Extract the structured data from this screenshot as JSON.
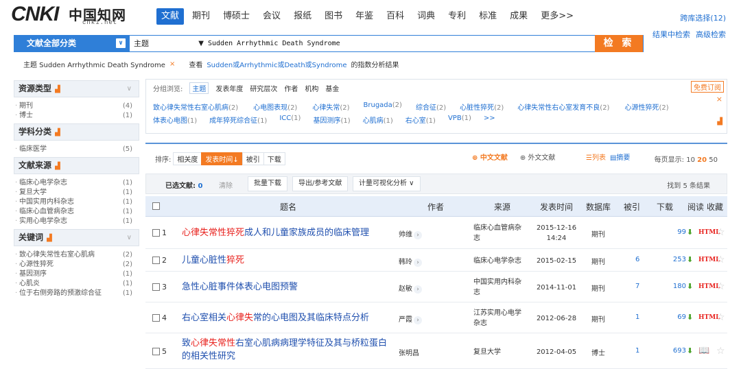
{
  "logo": {
    "mark": "CNKI",
    "cn": "中国知网",
    "sub": "cnki.net"
  },
  "nav": [
    "文献",
    "期刊",
    "博硕士",
    "会议",
    "报纸",
    "图书",
    "年鉴",
    "百科",
    "词典",
    "专利",
    "标准",
    "成果",
    "更多>>"
  ],
  "cross_db": "跨库选择(12)",
  "links": [
    "结果中检索",
    "高级检索"
  ],
  "search": {
    "category": "文献全部分类",
    "category_arrow": "∨",
    "field": "主题",
    "query": "Sudden Arrhythmic Death Syndrome",
    "button": "检 索"
  },
  "crumb": {
    "label": "主题 Sudden Arrhythmic Death Syndrome",
    "close": "×",
    "view_prefix": "查看",
    "terms": "Sudden或Arrhythmic或Death或Syndrome",
    "suffix": "的指数分析结果"
  },
  "sidebar": [
    {
      "title": "资源类型",
      "chev": "∨",
      "items": [
        {
          "label": "期刊",
          "count": "(4)"
        },
        {
          "label": "博士",
          "count": "(1)"
        }
      ]
    },
    {
      "title": "学科分类",
      "chev": "",
      "items": [
        {
          "label": "临床医学",
          "count": "(5)"
        }
      ]
    },
    {
      "title": "文献来源",
      "chev": "",
      "items": [
        {
          "label": "临床心电学杂志",
          "count": "(1)"
        },
        {
          "label": "复旦大学",
          "count": "(1)"
        },
        {
          "label": "中国实用内科杂志",
          "count": "(1)"
        },
        {
          "label": "临床心血管病杂志",
          "count": "(1)"
        },
        {
          "label": "实用心电学杂志",
          "count": "(1)"
        }
      ]
    },
    {
      "title": "关键词",
      "chev": "∨",
      "items": [
        {
          "label": "致心律失常性右室心肌病",
          "count": "(2)"
        },
        {
          "label": "心源性猝死",
          "count": "(2)"
        },
        {
          "label": "基因测序",
          "count": "(1)"
        },
        {
          "label": "心肌炎",
          "count": "(1)"
        },
        {
          "label": "位于右侧旁路的预激综合征",
          "count": "(1)"
        }
      ]
    }
  ],
  "group": {
    "label": "分组浏览:",
    "tabs": [
      "主题",
      "发表年度",
      "研究层次",
      "作者",
      "机构",
      "基金"
    ],
    "subscribe": "免费订阅",
    "close": "×",
    "row1": [
      {
        "t": "致心律失常性右室心肌病",
        "n": "(2)"
      },
      {
        "t": "心电图表现",
        "n": "(2)"
      },
      {
        "t": "心律失常",
        "n": "(2)"
      },
      {
        "t": "Brugada",
        "n": "(2)"
      },
      {
        "t": "综合征",
        "n": "(2)"
      },
      {
        "t": "心脏性猝死",
        "n": "(2)"
      },
      {
        "t": "心律失常性右心室发育不良",
        "n": "(2)"
      },
      {
        "t": "心源性猝死",
        "n": "(2)"
      }
    ],
    "row2": [
      {
        "t": "体表心电图",
        "n": "(1)"
      },
      {
        "t": "成年猝死综合征",
        "n": "(1)"
      },
      {
        "t": "ICC",
        "n": "(1)"
      },
      {
        "t": "基因测序",
        "n": "(1)"
      },
      {
        "t": "心肌病",
        "n": "(1)"
      },
      {
        "t": "右心室",
        "n": "(1)"
      },
      {
        "t": "VPB",
        "n": "(1)"
      },
      {
        "t": ">>",
        "n": ""
      }
    ]
  },
  "sort": {
    "label": "排序:",
    "opts": [
      "相关度",
      "发表时间↓",
      "被引",
      "下载"
    ]
  },
  "langs": {
    "cn": "中文文献",
    "en": "外文文献"
  },
  "views": {
    "list": "列表",
    "abstract": "摘要"
  },
  "perpage": {
    "label": "每页显示:",
    "opts": [
      "10",
      "20",
      "50"
    ]
  },
  "selbar": {
    "label": "已选文献:",
    "count": "0",
    "clear": "清除",
    "buttons": [
      "批量下载",
      "导出/参考文献",
      "计量可视化分析 ∨"
    ],
    "found": "找到 5 条结果"
  },
  "thead": {
    "title": "题名",
    "author": "作者",
    "source": "来源",
    "date": "发表时间",
    "db": "数据库",
    "cited": "被引",
    "dl": "下载",
    "read": "阅读",
    "fav": "收藏"
  },
  "rows": [
    {
      "n": "1",
      "t1": "",
      "kw": "心律失常性猝死",
      "t2": "成人和儿童家族成员的临床管理",
      "author": "帅维",
      "src": "临床心血管病杂志",
      "date": "2015-12-16 14:24",
      "db": "期刊",
      "cited": "",
      "dl": "99",
      "read": "HTML"
    },
    {
      "n": "2",
      "t1": "儿童心脏性",
      "kw": "猝死",
      "t2": "",
      "author": "韩玲",
      "src": "临床心电学杂志",
      "date": "2015-02-15",
      "db": "期刊",
      "cited": "6",
      "dl": "253",
      "read": "HTML"
    },
    {
      "n": "3",
      "t1": "急性心脏事件体表心电图预警",
      "kw": "",
      "t2": "",
      "author": "赵敏",
      "src": "中国实用内科杂志",
      "date": "2014-11-01",
      "db": "期刊",
      "cited": "7",
      "dl": "180",
      "read": "HTML"
    },
    {
      "n": "4",
      "t1": "右心室相关",
      "kw": "心律失",
      "t2": "常的心电图及其临床特点分析",
      "author": "严霞",
      "src": "江苏实用心电学杂志",
      "date": "2012-06-28",
      "db": "期刊",
      "cited": "1",
      "dl": "69",
      "read": "HTML"
    },
    {
      "n": "5",
      "t1": "致",
      "kw": "心律失常性",
      "t2": "右室心肌病病理学特征及其与桥粒蛋白的相关性研究",
      "author": "张明昌",
      "src": "复旦大学",
      "date": "2012-04-05",
      "db": "博士",
      "cited": "1",
      "dl": "693",
      "read": "📖"
    }
  ]
}
